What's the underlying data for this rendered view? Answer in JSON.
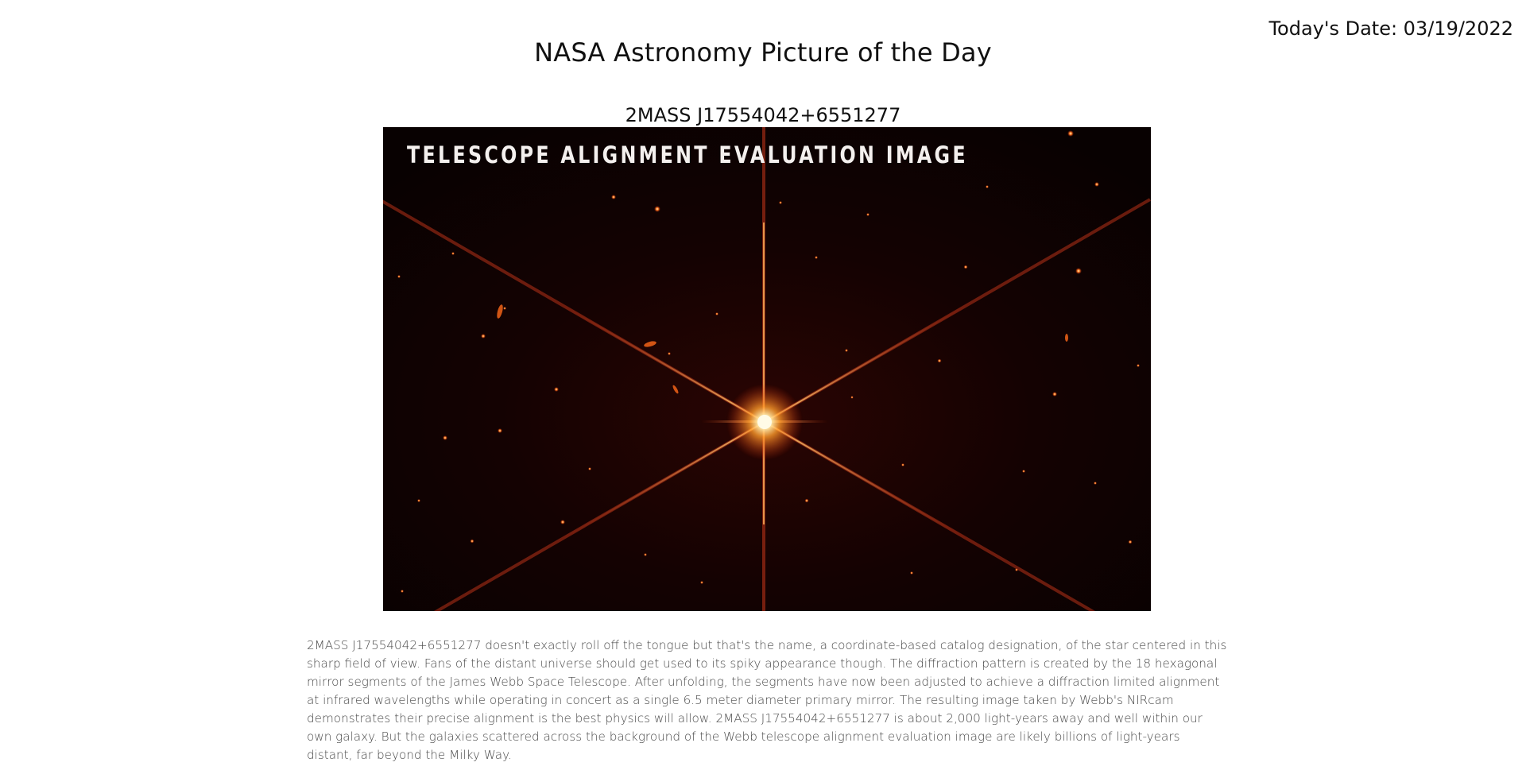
{
  "header": {
    "title": "NASA Astronomy Picture of the Day",
    "date_text": "Today's Date: 03/19/2022"
  },
  "apod": {
    "object_title": "2MASS J17554042+6551277",
    "image_overlay_text": "TELESCOPE ALIGNMENT EVALUATION IMAGE",
    "image_description": "Webb telescope alignment image with a bright six-spiked star on a dark red field",
    "explanation": "2MASS J17554042+6551277 doesn't exactly roll off the tongue but that's the name, a coordinate-based catalog designation, of the star centered in this sharp field of view. Fans of the distant universe should get used to its spiky appearance though. The diffraction pattern is created by the 18 hexagonal mirror segments of the James Webb Space Telescope. After unfolding, the segments have now been adjusted to achieve a diffraction limited alignment at infrared wavelengths while operating in concert as a single 6.5 meter diameter primary mirror. The resulting image taken by Webb's NIRcam demonstrates their precise alignment is the best physics will allow. 2MASS J17554042+6551277 is about 2,000 light-years away and well within our own galaxy. But the galaxies scattered across the background of the Webb telescope alignment evaluation image are likely billions of light-years distant, far beyond the Milky Way."
  },
  "colors": {
    "background": "#ffffff",
    "image_background": "#0a0101",
    "star_core": "#fff6d0",
    "spike": "#e0511a"
  }
}
